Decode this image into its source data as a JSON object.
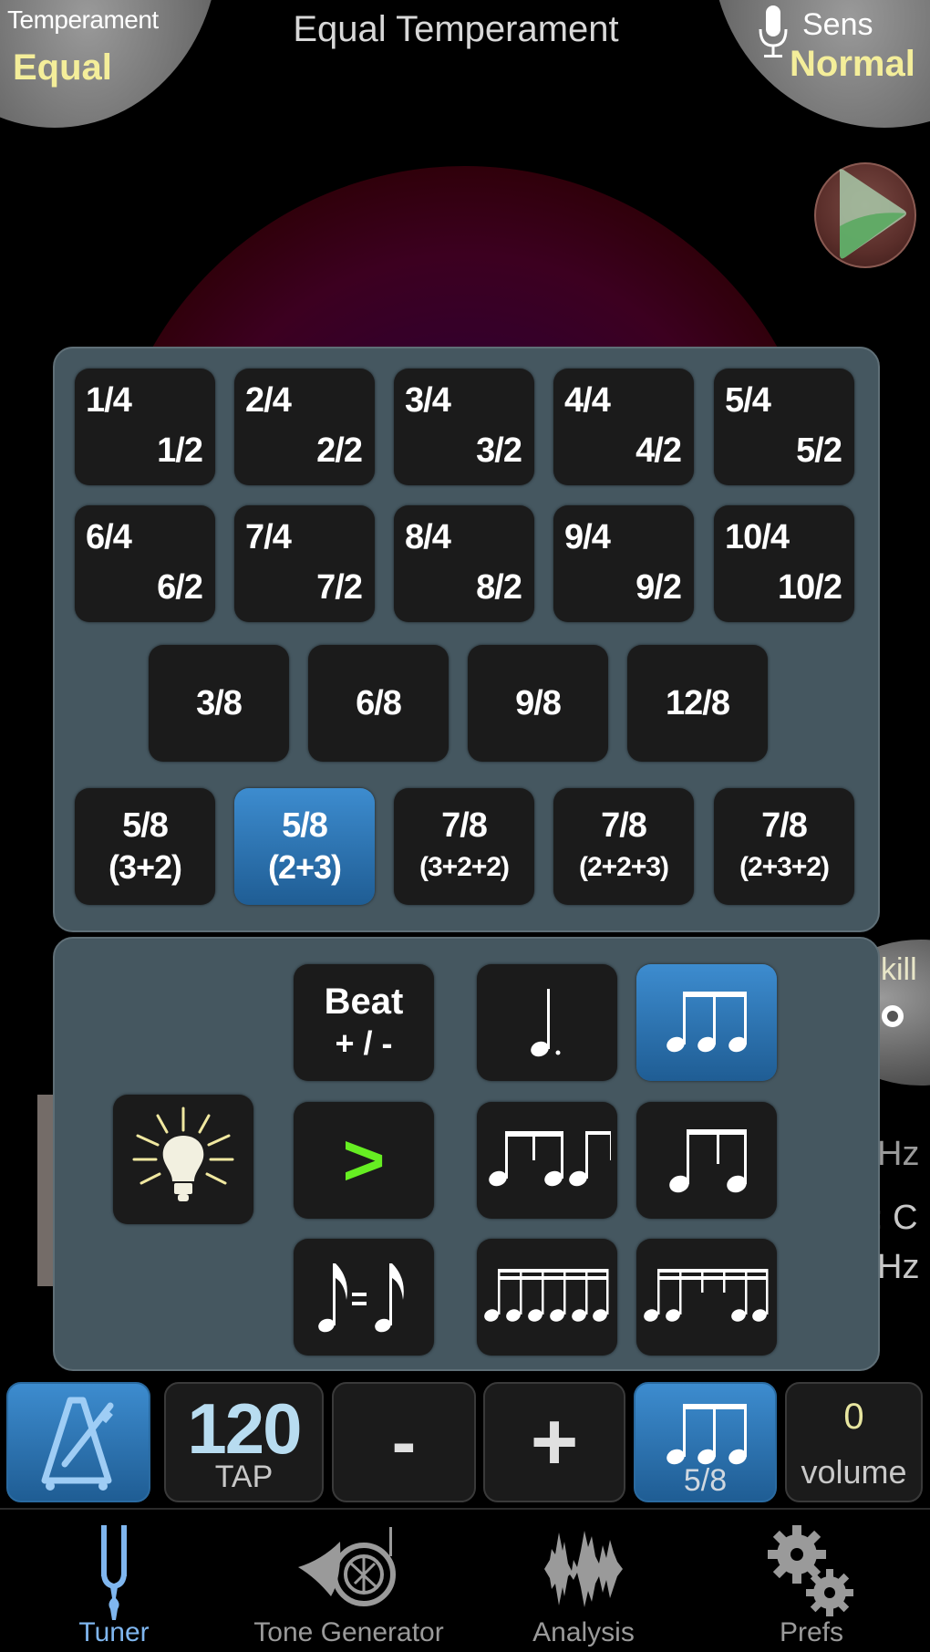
{
  "header": {
    "title": "Equal Temperament",
    "temperament": {
      "label": "Temperament",
      "value": "Equal"
    },
    "sensitivity": {
      "label": "Sens",
      "value": "Normal"
    }
  },
  "time_signature_panel": {
    "simple": [
      {
        "top": "1/4",
        "bottom": "1/2"
      },
      {
        "top": "2/4",
        "bottom": "2/2"
      },
      {
        "top": "3/4",
        "bottom": "3/2"
      },
      {
        "top": "4/4",
        "bottom": "4/2"
      },
      {
        "top": "5/4",
        "bottom": "5/2"
      },
      {
        "top": "6/4",
        "bottom": "6/2"
      },
      {
        "top": "7/4",
        "bottom": "7/2"
      },
      {
        "top": "8/4",
        "bottom": "8/2"
      },
      {
        "top": "9/4",
        "bottom": "9/2"
      },
      {
        "top": "10/4",
        "bottom": "10/2"
      }
    ],
    "compound": [
      "3/8",
      "6/8",
      "9/8",
      "12/8"
    ],
    "asymmetric": [
      {
        "sig": "5/8",
        "grouping": "(3+2)",
        "selected": false
      },
      {
        "sig": "5/8",
        "grouping": "(2+3)",
        "selected": true
      },
      {
        "sig": "7/8",
        "grouping": "(3+2+2)",
        "selected": false
      },
      {
        "sig": "7/8",
        "grouping": "(2+2+3)",
        "selected": false
      },
      {
        "sig": "7/8",
        "grouping": "(2+3+2)",
        "selected": false
      }
    ]
  },
  "beat_panel": {
    "beat_button": {
      "line1": "Beat",
      "line2": "+ / -"
    },
    "accent_symbol": ">",
    "equals_symbol": "=",
    "subdivisions": [
      {
        "icon": "dotted-quarter-note-icon",
        "selected": false
      },
      {
        "icon": "triple-eighth-notes-icon",
        "selected": true
      },
      {
        "icon": "eighth-rest-eighth-pattern-icon",
        "selected": false
      },
      {
        "icon": "eighth-rest-eighth-icon",
        "selected": false
      },
      {
        "icon": "six-sixteenth-notes-icon",
        "selected": false
      },
      {
        "icon": "sixteenth-rest-pattern-icon",
        "selected": false
      }
    ]
  },
  "background_readouts": {
    "skill_label": "kill",
    "hz_1": "Hz",
    "note": ": C",
    "hz_2": "Hz"
  },
  "metronome_bar": {
    "tempo": "120",
    "tap_label": "TAP",
    "minus_label": "-",
    "plus_label": "+",
    "time_signature": "5/8",
    "volume_value": "0",
    "volume_label": "volume"
  },
  "tabs": [
    {
      "label": "Tuner",
      "icon": "tuning-fork-icon",
      "active": true
    },
    {
      "label": "Tone Generator",
      "icon": "french-horn-icon",
      "active": false
    },
    {
      "label": "Analysis",
      "icon": "waveform-icon",
      "active": false
    },
    {
      "label": "Prefs",
      "icon": "gears-icon",
      "active": false
    }
  ],
  "colors": {
    "accent_blue": "#3d8ccf",
    "label_yellow": "#f4ee9a",
    "panel": "#455760",
    "button": "#1b1b1b",
    "accent_green": "#66ee22",
    "tab_active": "#7fb6ef"
  }
}
